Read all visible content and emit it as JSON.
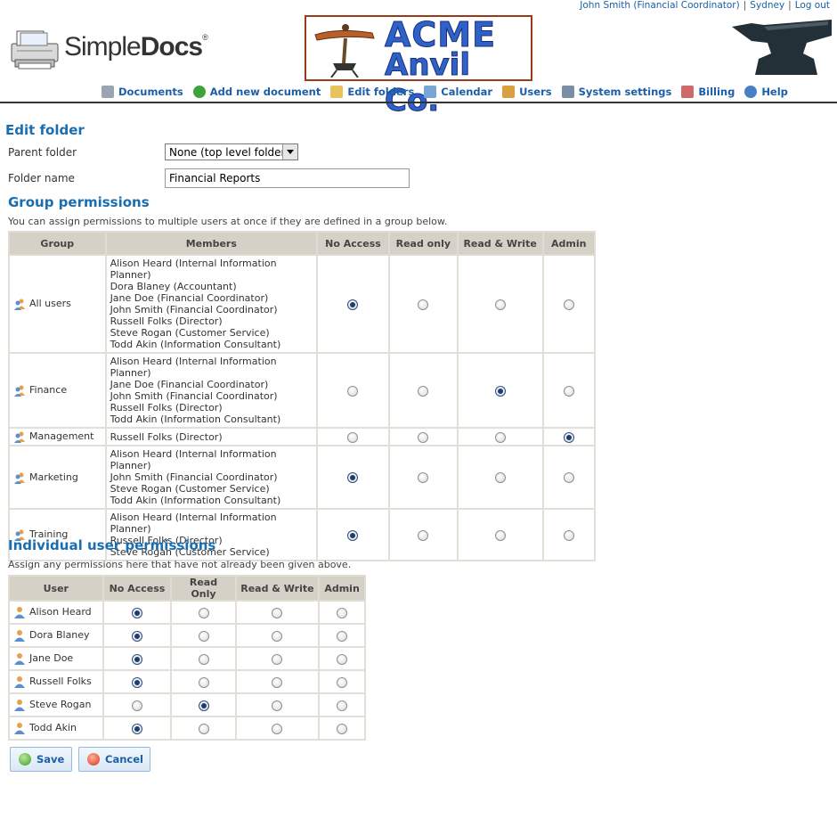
{
  "header": {
    "user_link": "John Smith (Financial Coordinator)",
    "location_link": "Sydney",
    "logout_link": "Log out",
    "logo_simple": "Simple",
    "logo_docs": "Docs",
    "logo_reg": "®",
    "company_line1": "ACME",
    "company_line2": "Anvil Co."
  },
  "nav": [
    {
      "label": "Documents",
      "icon": "document-icon"
    },
    {
      "label": "Add new document",
      "icon": "add-icon"
    },
    {
      "label": "Edit folders",
      "icon": "folder-icon"
    },
    {
      "label": "Calendar",
      "icon": "calendar-icon"
    },
    {
      "label": "Users",
      "icon": "users-icon"
    },
    {
      "label": "System settings",
      "icon": "wrench-icon"
    },
    {
      "label": "Billing",
      "icon": "billing-icon"
    },
    {
      "label": "Help",
      "icon": "help-icon"
    }
  ],
  "form": {
    "title": "Edit folder",
    "parent_label": "Parent folder",
    "parent_value": "None (top level folder)",
    "name_label": "Folder name",
    "name_value": "Financial Reports"
  },
  "group_section": {
    "title": "Group permissions",
    "description": "You can assign permissions to multiple users at once if they are defined in a group below.",
    "columns": [
      "Group",
      "Members",
      "No Access",
      "Read only",
      "Read & Write",
      "Admin"
    ],
    "rows": [
      {
        "group": "All users",
        "members": [
          "Alison Heard (Internal Information Planner)",
          "Dora Blaney (Accountant)",
          "Jane Doe (Financial Coordinator)",
          "John Smith (Financial Coordinator)",
          "Russell Folks (Director)",
          "Steve Rogan (Customer Service)",
          "Todd Akin (Information Consultant)"
        ],
        "selected": 0
      },
      {
        "group": "Finance",
        "members": [
          "Alison Heard (Internal Information Planner)",
          "Jane Doe (Financial Coordinator)",
          "John Smith (Financial Coordinator)",
          "Russell Folks (Director)",
          "Todd Akin (Information Consultant)"
        ],
        "selected": 2
      },
      {
        "group": "Management",
        "members": [
          "Russell Folks (Director)"
        ],
        "selected": 3
      },
      {
        "group": "Marketing",
        "members": [
          "Alison Heard (Internal Information Planner)",
          "John Smith (Financial Coordinator)",
          "Steve Rogan (Customer Service)",
          "Todd Akin (Information Consultant)"
        ],
        "selected": 0
      },
      {
        "group": "Training",
        "members": [
          "Alison Heard (Internal Information Planner)",
          "Russell Folks (Director)",
          "Steve Rogan (Customer Service)"
        ],
        "selected": 0
      }
    ]
  },
  "user_section": {
    "title": "Individual user permissions",
    "description": "Assign any permissions here that have not already been given above.",
    "columns": [
      "User",
      "No Access",
      "Read Only",
      "Read & Write",
      "Admin"
    ],
    "rows": [
      {
        "user": "Alison Heard",
        "selected": 0
      },
      {
        "user": "Dora Blaney",
        "selected": 0
      },
      {
        "user": "Jane Doe",
        "selected": 0
      },
      {
        "user": "Russell Folks",
        "selected": 0
      },
      {
        "user": "Steve Rogan",
        "selected": 1
      },
      {
        "user": "Todd Akin",
        "selected": 0
      }
    ]
  },
  "buttons": {
    "save": "Save",
    "cancel": "Cancel"
  },
  "colors": {
    "accent": "#1a6eb0",
    "link": "#1a5fa8",
    "table_header": "#d6d1c7"
  }
}
